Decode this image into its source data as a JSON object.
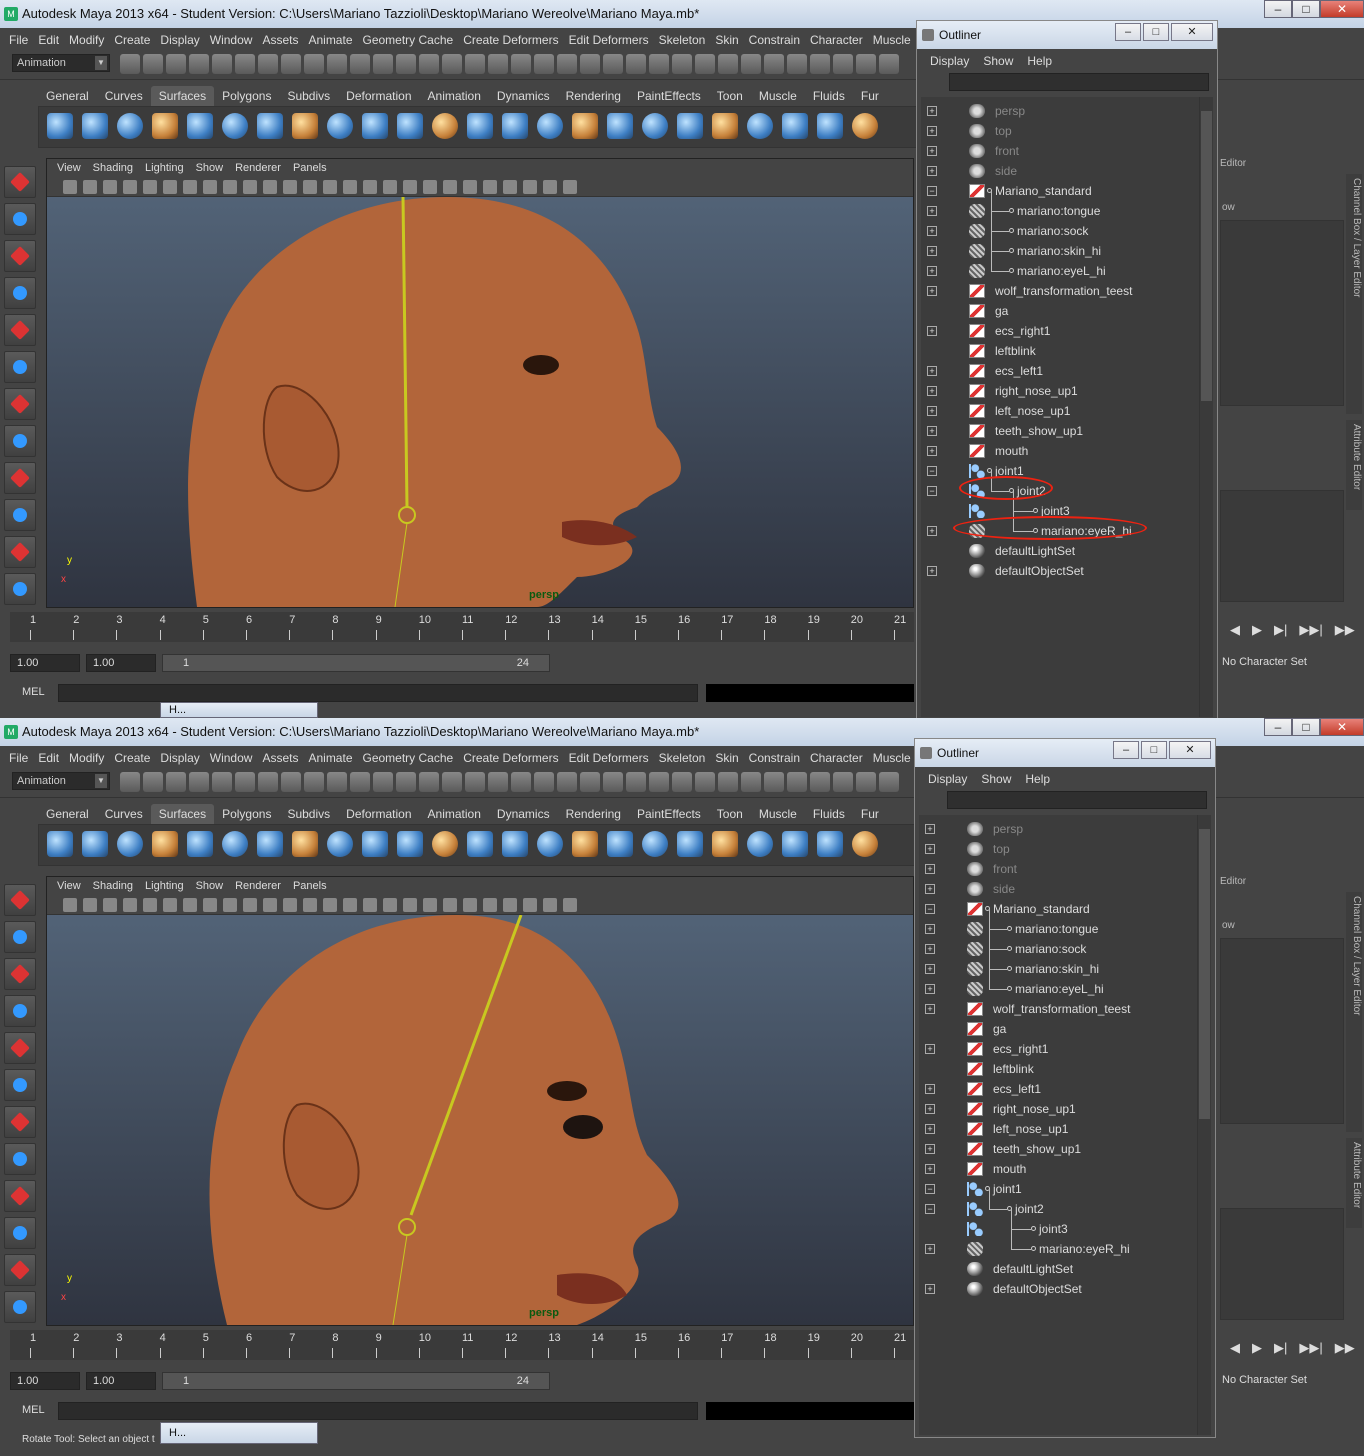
{
  "window_title": "Autodesk Maya 2013 x64 - Student Version: C:\\Users\\Mariano Tazzioli\\Desktop\\Mariano Wereolve\\Mariano Maya.mb*",
  "menu": [
    "File",
    "Edit",
    "Modify",
    "Create",
    "Display",
    "Window",
    "Assets",
    "Animate",
    "Geometry Cache",
    "Create Deformers",
    "Edit Deformers",
    "Skeleton",
    "Skin",
    "Constrain",
    "Character",
    "Muscle"
  ],
  "mode_select": "Animation",
  "shelf_tabs": [
    "General",
    "Curves",
    "Surfaces",
    "Polygons",
    "Subdivs",
    "Deformation",
    "Animation",
    "Dynamics",
    "Rendering",
    "PaintEffects",
    "Toon",
    "Muscle",
    "Fluids",
    "Fur"
  ],
  "shelf_active": "Surfaces",
  "viewport_menu": [
    "View",
    "Shading",
    "Lighting",
    "Show",
    "Renderer",
    "Panels"
  ],
  "camera_label": "persp",
  "axis": {
    "y": "y",
    "x": "x"
  },
  "timeline_numbers": [
    "1",
    "2",
    "3",
    "4",
    "5",
    "6",
    "7",
    "8",
    "9",
    "10",
    "11",
    "12",
    "13",
    "14",
    "15",
    "16",
    "17",
    "18",
    "19",
    "20",
    "21"
  ],
  "range": {
    "start": "1.00",
    "current": "1.00",
    "slider_start": "1",
    "slider_end": "24"
  },
  "mel_label": "MEL",
  "mini_window_title": "H...",
  "help_line": "Rotate Tool: Select an object t",
  "right_panel": {
    "editor_label": "Editor",
    "ow_label": "ow",
    "no_character": "No Character Set",
    "tab_channel": "Channel Box / Layer Editor",
    "tab_attribute": "Attribute Editor"
  },
  "outliner": {
    "title": "Outliner",
    "menu": [
      "Display",
      "Show",
      "Help"
    ],
    "top_items": [
      {
        "name": "persp",
        "icon": "camera-icon",
        "dim": true,
        "expander": "+",
        "indent": 0
      },
      {
        "name": "top",
        "icon": "camera-icon",
        "dim": true,
        "expander": "+",
        "indent": 0
      },
      {
        "name": "front",
        "icon": "camera-icon",
        "dim": true,
        "expander": "+",
        "indent": 0
      },
      {
        "name": "side",
        "icon": "camera-icon",
        "dim": true,
        "expander": "+",
        "indent": 0
      },
      {
        "name": "Mariano_standard",
        "icon": "blendshape-icon",
        "dim": false,
        "expander": "−",
        "indent": 0
      },
      {
        "name": "mariano:tongue",
        "icon": "mesh-icon",
        "dim": false,
        "expander": "+",
        "indent": 1
      },
      {
        "name": "mariano:sock",
        "icon": "mesh-icon",
        "dim": false,
        "expander": "+",
        "indent": 1
      },
      {
        "name": "mariano:skin_hi",
        "icon": "mesh-icon",
        "dim": false,
        "expander": "+",
        "indent": 1
      },
      {
        "name": "mariano:eyeL_hi",
        "icon": "mesh-icon",
        "dim": false,
        "expander": "+",
        "indent": 1
      },
      {
        "name": "wolf_transformation_teest",
        "icon": "blendshape-icon",
        "dim": false,
        "expander": "+",
        "indent": 0
      },
      {
        "name": "ga",
        "icon": "blendshape-icon",
        "dim": false,
        "expander": "",
        "indent": 0
      },
      {
        "name": "ecs_right1",
        "icon": "blendshape-icon",
        "dim": false,
        "expander": "+",
        "indent": 0
      },
      {
        "name": "leftblink",
        "icon": "blendshape-icon",
        "dim": false,
        "expander": "",
        "indent": 0
      },
      {
        "name": "ecs_left1",
        "icon": "blendshape-icon",
        "dim": false,
        "expander": "+",
        "indent": 0
      },
      {
        "name": "right_nose_up1",
        "icon": "blendshape-icon",
        "dim": false,
        "expander": "+",
        "indent": 0
      },
      {
        "name": "left_nose_up1",
        "icon": "blendshape-icon",
        "dim": false,
        "expander": "+",
        "indent": 0
      },
      {
        "name": "teeth_show_up1",
        "icon": "blendshape-icon",
        "dim": false,
        "expander": "+",
        "indent": 0
      },
      {
        "name": "mouth",
        "icon": "blendshape-icon",
        "dim": false,
        "expander": "+",
        "indent": 0
      },
      {
        "name": "joint1",
        "icon": "joint-icon",
        "dim": false,
        "expander": "−",
        "indent": 0
      },
      {
        "name": "joint2",
        "icon": "joint-icon",
        "dim": false,
        "expander": "−",
        "indent": 1
      },
      {
        "name": "joint3",
        "icon": "joint-icon",
        "dim": false,
        "expander": "",
        "indent": 2
      },
      {
        "name": "mariano:eyeR_hi",
        "icon": "mesh-icon",
        "dim": false,
        "expander": "+",
        "indent": 2
      },
      {
        "name": "defaultLightSet",
        "icon": "set-icon",
        "dim": false,
        "expander": "",
        "indent": 0
      },
      {
        "name": "defaultObjectSet",
        "icon": "set-icon",
        "dim": false,
        "expander": "+",
        "indent": 0
      }
    ]
  }
}
